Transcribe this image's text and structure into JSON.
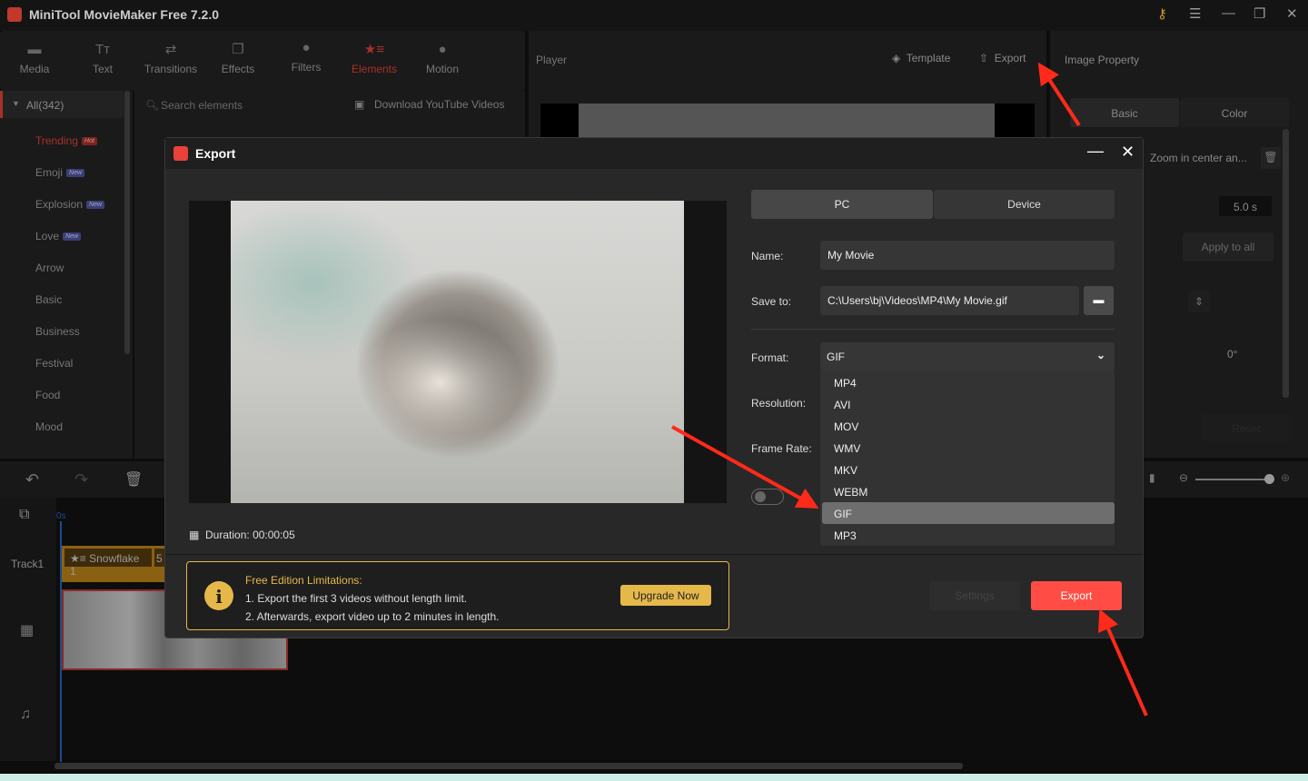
{
  "app": {
    "title": "MiniTool MovieMaker Free 7.2.0"
  },
  "toolbar": [
    {
      "label": "Media",
      "icon": "folder-icon"
    },
    {
      "label": "Text",
      "icon": "text-icon"
    },
    {
      "label": "Transitions",
      "icon": "transitions-icon"
    },
    {
      "label": "Effects",
      "icon": "effects-icon"
    },
    {
      "label": "Filters",
      "icon": "filters-icon"
    },
    {
      "label": "Elements",
      "icon": "elements-icon",
      "active": true
    },
    {
      "label": "Motion",
      "icon": "motion-icon"
    }
  ],
  "library": {
    "all": "All(342)",
    "search_placeholder": "Search elements",
    "download": "Download YouTube Videos",
    "categories": [
      {
        "label": "Trending",
        "badge": "Hot"
      },
      {
        "label": "Emoji",
        "badge": "New"
      },
      {
        "label": "Explosion",
        "badge": "New"
      },
      {
        "label": "Love",
        "badge": "New"
      },
      {
        "label": "Arrow"
      },
      {
        "label": "Basic"
      },
      {
        "label": "Business"
      },
      {
        "label": "Festival"
      },
      {
        "label": "Food"
      },
      {
        "label": "Mood"
      }
    ]
  },
  "player": {
    "title": "Player",
    "template": "Template",
    "export": "Export"
  },
  "property": {
    "title": "Image Property",
    "tabs": [
      "Basic",
      "Color"
    ],
    "effect": "Zoom in center an...",
    "duration": "5.0 s",
    "apply_all": "Apply to all",
    "rotation": "0°",
    "reset": "Reset"
  },
  "timeline": {
    "time0": "0s",
    "track": "Track1",
    "clip": "Snowflake 1",
    "clip2": "5"
  },
  "export_dialog": {
    "title": "Export",
    "tabs": [
      "PC",
      "Device"
    ],
    "name_label": "Name:",
    "name": "My Movie",
    "save_label": "Save to:",
    "save_path": "C:\\Users\\bj\\Videos\\MP4\\My Movie.gif",
    "format_label": "Format:",
    "format": "GIF",
    "resolution_label": "Resolution:",
    "framerate_label": "Frame Rate:",
    "formats": [
      "MP4",
      "AVI",
      "MOV",
      "WMV",
      "MKV",
      "WEBM",
      "GIF",
      "MP3"
    ],
    "selected_format": "GIF",
    "duration_label": "Duration:",
    "duration": "00:00:05",
    "limit_title": "Free Edition Limitations:",
    "limit_1": "1. Export the first 3 videos without length limit.",
    "limit_2": "2. Afterwards, export video up to 2 minutes in length.",
    "upgrade": "Upgrade Now",
    "settings": "Settings",
    "export": "Export"
  },
  "colors": {
    "accent": "#ff4d45",
    "gold": "#e6b84a",
    "elements_active": "#a8302a"
  }
}
